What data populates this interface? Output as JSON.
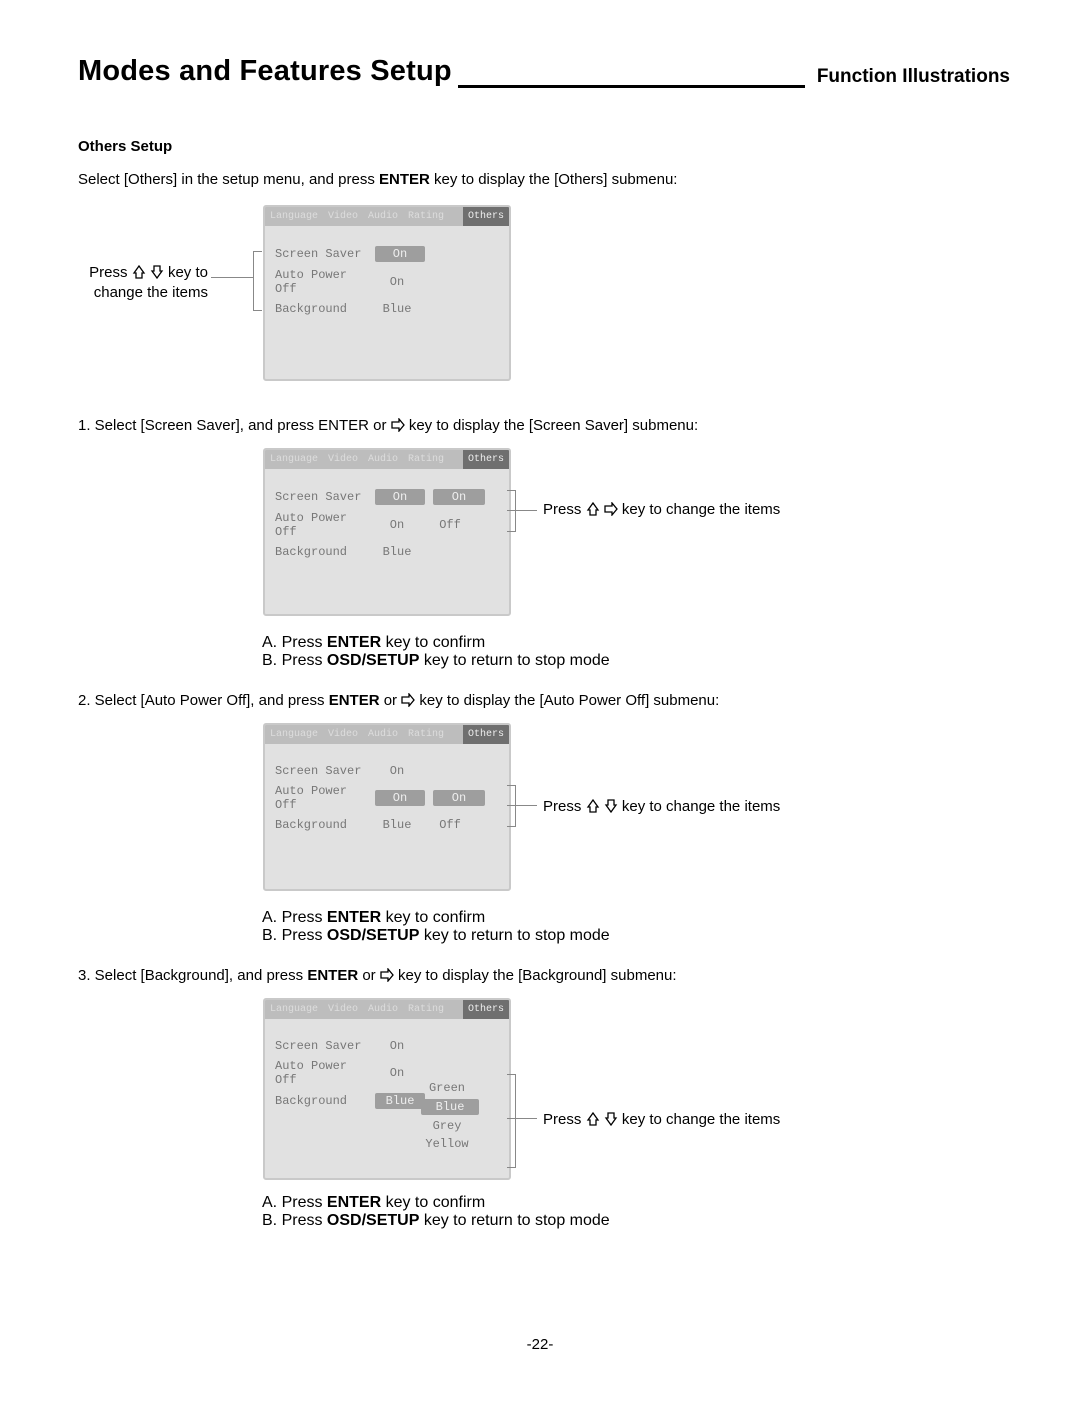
{
  "header": {
    "title": "Modes and Features Setup",
    "subtitle": "Function Illustrations"
  },
  "section_title": "Others Setup",
  "intro_a": "Select [Others] in the setup menu, and press ",
  "intro_enter": "ENTER",
  "intro_b": " key to display the [Others] submenu:",
  "callout_left_a": "Press ",
  "callout_left_b": " key to",
  "callout_left_c": "change the items",
  "tabs": {
    "language": "Language",
    "video": "Video",
    "audio": "Audio",
    "rating": "Rating",
    "others": "Others"
  },
  "items": {
    "screen_saver": "Screen Saver",
    "auto_power_off": "Auto Power Off",
    "background": "Background"
  },
  "vals": {
    "on": "On",
    "off": "Off",
    "blue": "Blue",
    "green": "Green",
    "grey": "Grey",
    "yellow": "Yellow"
  },
  "step1_a": "1. Select [Screen Saver], and press ENTER or ",
  "step1_b": " key to display the [Screen Saver] submenu:",
  "callout_r1_a": "Press ",
  "callout_r1_b": " key to change the items",
  "confirm_a": "A. Press ",
  "confirm_enter": "ENTER",
  "confirm_a2": " key to confirm",
  "confirm_b1": "B. Press ",
  "confirm_osd": "OSD/SETUP",
  "confirm_b2": " key to return to stop mode",
  "step2_a": "2. Select [Auto Power Off], and press ",
  "step2_enter": "ENTER",
  "step2_b": " or ",
  "step2_c": " key to display the [Auto Power Off] submenu:",
  "callout_r2_a": "Press ",
  "callout_r2_b": " key to change the items",
  "step3_a": "3. Select [Background], and press ",
  "step3_enter": "ENTER",
  "step3_b": " or ",
  "step3_c": " key to display the [Background] submenu:",
  "callout_r3_a": "Press",
  "callout_r3_b": "key to change the items",
  "page_number": "-22-"
}
